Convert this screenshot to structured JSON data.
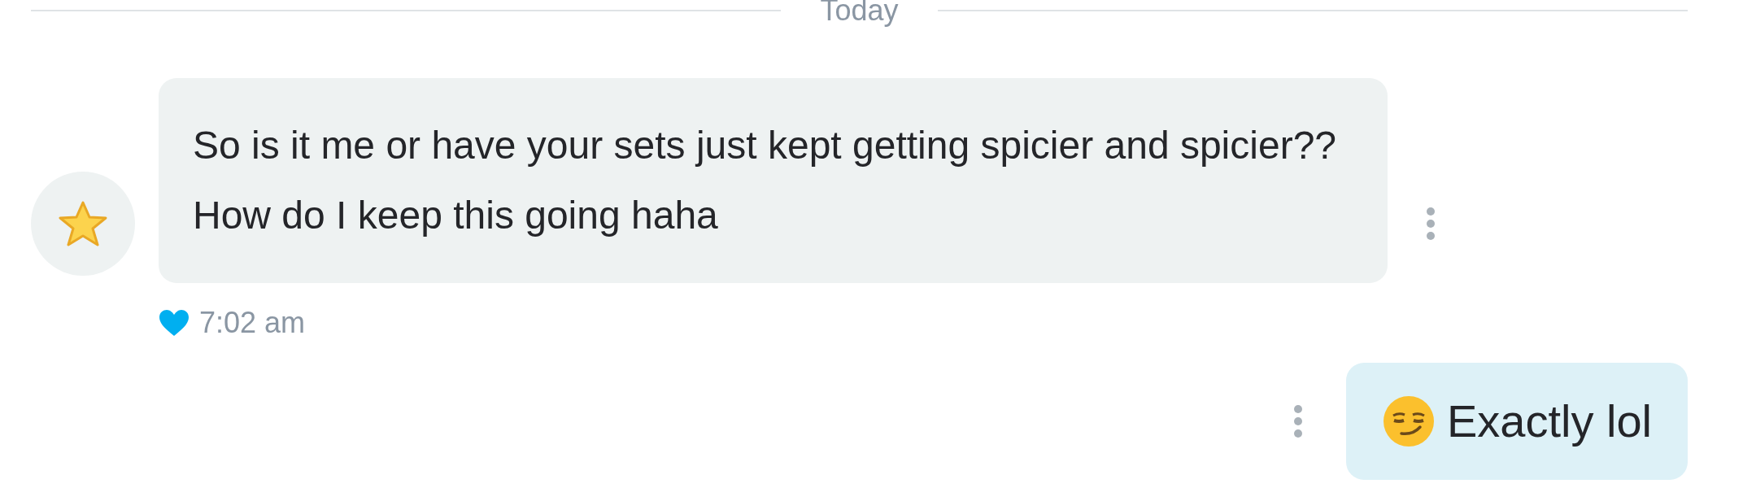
{
  "divider": {
    "label": "Today"
  },
  "messages": [
    {
      "kind": "incoming",
      "text": "So is it me or have your sets just kept getting spicier and spicier?? How do I keep this going haha",
      "liked": true,
      "time": "7:02 am"
    },
    {
      "kind": "outgoing",
      "text": "Exactly lol"
    }
  ]
}
